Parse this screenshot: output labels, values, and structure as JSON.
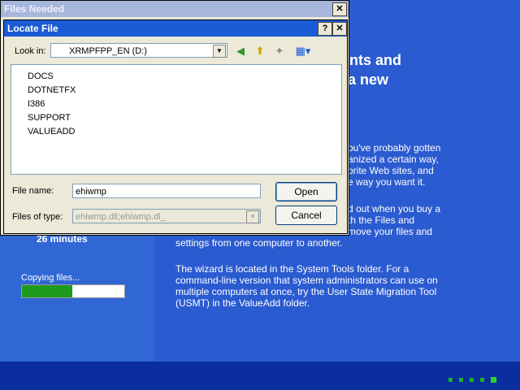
{
  "background": {
    "heading_lines": [
      "nts and",
      "a new"
    ],
    "para1": [
      "ou've probably gotten",
      "anized a certain way,",
      "orite Web sites, and",
      "e way you want it."
    ],
    "para2": [
      "d out when you buy a",
      "th the Files and",
      "move your files and",
      "settings from one computer to another."
    ],
    "para3": [
      "The wizard is located in the System Tools folder. For a",
      "command-line version that system administrators can use on",
      "multiple computers at once, try the User State Migration Tool",
      "(USMT) in the ValueAdd folder."
    ],
    "time_remaining": "26 minutes",
    "copying_label": "Copying files...",
    "progress_fraction": 0.49
  },
  "files_needed": {
    "title": "Files Needed",
    "close_glyph": "✕"
  },
  "locate_file": {
    "title": "Locate File",
    "help_glyph": "?",
    "close_glyph": "✕",
    "look_in_label": "Look in:",
    "look_in_value": "XRMPFPP_EN (D:)",
    "items": [
      "DOCS",
      "DOTNETFX",
      "I386",
      "SUPPORT",
      "VALUEADD"
    ],
    "file_name_label": "File name:",
    "file_name_value": "ehiwmp",
    "files_of_type_label": "Files of type:",
    "files_of_type_value": "ehiwmp.dll;ehiwmp.dl_",
    "open_label": "Open",
    "cancel_label": "Cancel"
  },
  "colors": {
    "accent": "#1c5bd6",
    "progress": "#1e9a1e"
  }
}
